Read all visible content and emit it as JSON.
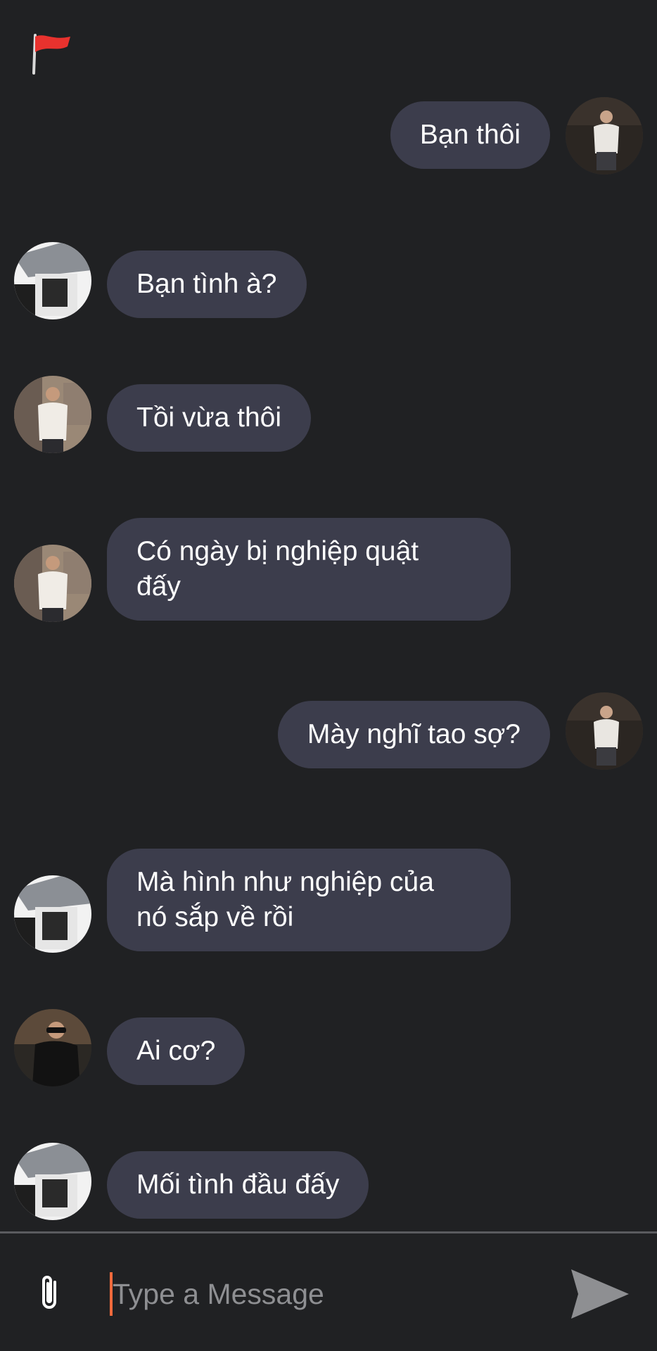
{
  "composer": {
    "placeholder": "Type a Message"
  },
  "icons": {
    "flag": "red-flag-icon",
    "attach": "paperclip-icon",
    "send": "send-arrow-icon"
  },
  "colors": {
    "background": "#202123",
    "bubble": "#3c3d4c",
    "flag": "#e8322e",
    "cursor": "#f06a3c",
    "divider": "#5a5b5f"
  },
  "messages": [
    {
      "side": "right",
      "text": "Bạn thôi"
    },
    {
      "side": "left",
      "text": "Bạn tình à?"
    },
    {
      "side": "left",
      "text": "Tồi vừa thôi"
    },
    {
      "side": "left",
      "text": "Có ngày bị nghiệp quật\nđấy"
    },
    {
      "side": "right",
      "text": "Mày nghĩ tao sợ?"
    },
    {
      "side": "left",
      "text": "Mà hình như nghiệp của\nnó sắp về rồi"
    },
    {
      "side": "left",
      "text": "Ai cơ?"
    },
    {
      "side": "left",
      "text": "Mối tình đầu đấy"
    }
  ]
}
